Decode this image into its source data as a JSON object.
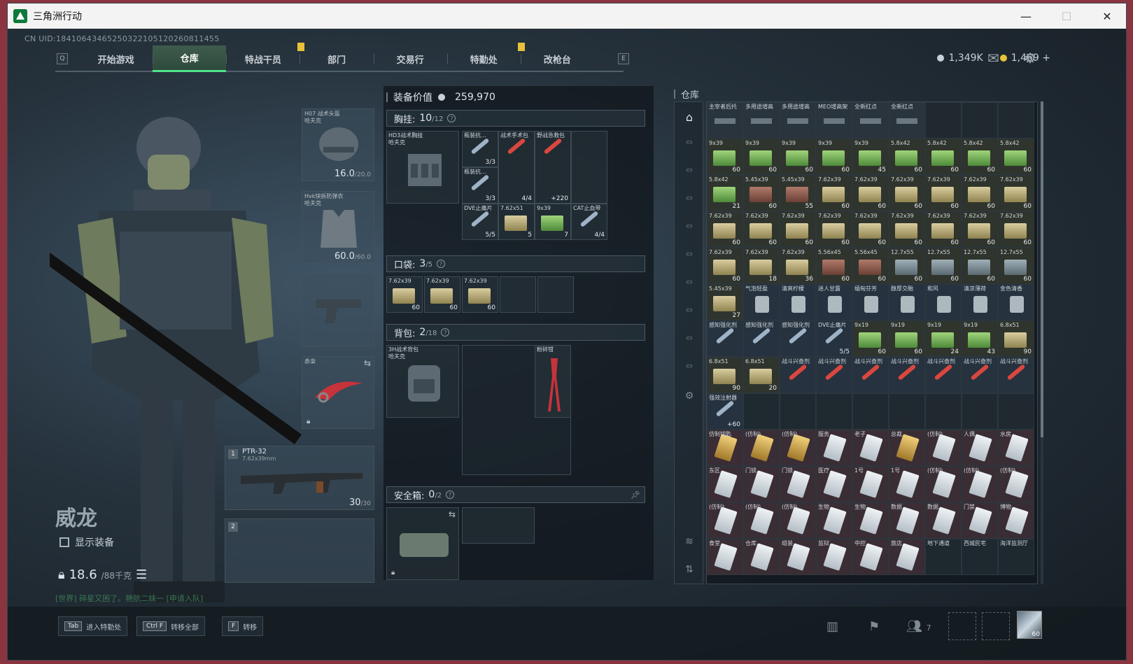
{
  "window": {
    "title": "三角洲行动",
    "minimize": "—",
    "maximize": "☐",
    "close": "✕"
  },
  "uid": "CN UID:18410643465250322105120260811455",
  "nav": {
    "left_key": "Q",
    "right_key": "E",
    "tabs": [
      "开始游戏",
      "仓库",
      "特战干员",
      "部门",
      "交易行",
      "特勤处",
      "改枪台"
    ],
    "active_index": 1
  },
  "currency": {
    "silver": "1,349K",
    "gold": "1,469",
    "plus": "+"
  },
  "character": {
    "name": "威龙",
    "show_equipment": "显示装备",
    "weight": "18.6",
    "weight_max": "/88千克",
    "chat": "[世界] 碎星又困了。艳航二妹一 [申请入队]"
  },
  "slots": {
    "helmet": {
      "label": "H07 战术头盔\n哈夫克",
      "value": "16.0",
      "max": "/20.0"
    },
    "armor": {
      "label": "Hvk快拆防弹衣\n哈夫克",
      "value": "60.0",
      "max": "/60.0"
    },
    "melee": {
      "label": "赤枭"
    },
    "primary": {
      "num": "1",
      "label": "PTR-32",
      "sub": "7.62x39mm",
      "value": "30",
      "max": "/30"
    },
    "secondary": {
      "num": "2"
    }
  },
  "gear": {
    "value_label": "装备价值",
    "value": "259,970",
    "chest": {
      "label": "胸挂:",
      "count": "10",
      "max": "/12",
      "rig": "HD3战术胸挂\n哈夫克"
    },
    "chest_items": [
      {
        "name": "瓶装抗…",
        "qty": "3/3"
      },
      {
        "name": "战术手术包",
        "qty": "4/4"
      },
      {
        "name": "野战急救包",
        "qty": "+220"
      },
      {
        "name": "瓶装抗…",
        "qty": "3/3"
      },
      {
        "name": "DVE止痛片",
        "qty": "5/5"
      },
      {
        "name": "7.62x51",
        "qty": "5"
      },
      {
        "name": "9x39",
        "qty": "7"
      },
      {
        "name": "CAT止血带",
        "qty": "4/4"
      }
    ],
    "pocket": {
      "label": "口袋:",
      "count": "3",
      "max": "/5",
      "items": [
        {
          "name": "7.62x39",
          "qty": "60"
        },
        {
          "name": "7.62x39",
          "qty": "60"
        },
        {
          "name": "7.62x39",
          "qty": "60"
        }
      ]
    },
    "backpack": {
      "label": "背包:",
      "count": "2",
      "max": "/18",
      "bag": "3H战术背包\n哈夫克",
      "tool": "粉碎钳"
    },
    "safe": {
      "label": "安全箱:",
      "count": "0",
      "max": "/2"
    }
  },
  "warehouse": {
    "title": "仓库",
    "rows": [
      [
        {
          "n": "主宰者后托",
          "k": "att"
        },
        {
          "n": "多用途增高",
          "k": "att"
        },
        {
          "n": "多用途增高",
          "k": "att"
        },
        {
          "n": "MEO增高架",
          "k": "att"
        },
        {
          "n": "全新红点",
          "k": "att"
        },
        {
          "n": "全新红点",
          "k": "att"
        },
        {
          "n": "",
          "k": "empty"
        },
        {
          "n": "",
          "k": "empty"
        },
        {
          "n": "",
          "k": "empty"
        }
      ],
      [
        {
          "n": "9x39",
          "q": "60",
          "k": "green"
        },
        {
          "n": "9x39",
          "q": "60",
          "k": "green"
        },
        {
          "n": "9x39",
          "q": "60",
          "k": "green"
        },
        {
          "n": "9x39",
          "q": "60",
          "k": "green"
        },
        {
          "n": "9x39",
          "q": "45",
          "k": "green"
        },
        {
          "n": "5.8x42",
          "q": "60",
          "k": "green"
        },
        {
          "n": "5.8x42",
          "q": "60",
          "k": "green"
        },
        {
          "n": "5.8x42",
          "q": "60",
          "k": "green"
        },
        {
          "n": "5.8x42",
          "q": "60",
          "k": "green"
        }
      ],
      [
        {
          "n": "5.8x42",
          "q": "21",
          "k": "green"
        },
        {
          "n": "5.45x39",
          "q": "60",
          "k": "rust"
        },
        {
          "n": "5.45x39",
          "q": "55",
          "k": "rust"
        },
        {
          "n": "7.62x39",
          "q": "60",
          "k": "tan"
        },
        {
          "n": "7.62x39",
          "q": "60",
          "k": "tan"
        },
        {
          "n": "7.62x39",
          "q": "60",
          "k": "tan"
        },
        {
          "n": "7.62x39",
          "q": "60",
          "k": "tan"
        },
        {
          "n": "7.62x39",
          "q": "60",
          "k": "tan"
        },
        {
          "n": "7.62x39",
          "q": "60",
          "k": "tan"
        }
      ],
      [
        {
          "n": "7.62x39",
          "q": "60",
          "k": "tan"
        },
        {
          "n": "7.62x39",
          "q": "60",
          "k": "tan"
        },
        {
          "n": "7.62x39",
          "q": "60",
          "k": "tan"
        },
        {
          "n": "7.62x39",
          "q": "60",
          "k": "tan"
        },
        {
          "n": "7.62x39",
          "q": "60",
          "k": "tan"
        },
        {
          "n": "7.62x39",
          "q": "60",
          "k": "tan"
        },
        {
          "n": "7.62x39",
          "q": "60",
          "k": "tan"
        },
        {
          "n": "7.62x39",
          "q": "60",
          "k": "tan"
        },
        {
          "n": "7.62x39",
          "q": "60",
          "k": "tan"
        }
      ],
      [
        {
          "n": "7.62x39",
          "q": "60",
          "k": "tan"
        },
        {
          "n": "7.62x39",
          "q": "18",
          "k": "tan"
        },
        {
          "n": "7.62x39",
          "q": "36",
          "k": "tan"
        },
        {
          "n": "5.56x45",
          "q": "60",
          "k": "rust"
        },
        {
          "n": "5.56x45",
          "q": "60",
          "k": "rust"
        },
        {
          "n": "12.7x55",
          "q": "60",
          "k": "grey"
        },
        {
          "n": "12.7x55",
          "q": "60",
          "k": "grey"
        },
        {
          "n": "12.7x55",
          "q": "60",
          "k": "grey"
        },
        {
          "n": "12.7x55",
          "q": "60",
          "k": "grey"
        }
      ],
      [
        {
          "n": "5.45x39",
          "q": "27",
          "k": "tan"
        },
        {
          "n": "气泡轻盈",
          "k": "drink"
        },
        {
          "n": "清爽柠檬",
          "k": "drink"
        },
        {
          "n": "迷人甘露",
          "k": "drink"
        },
        {
          "n": "缅甸芬芳",
          "k": "drink"
        },
        {
          "n": "醇厚交融",
          "k": "drink"
        },
        {
          "n": "和风",
          "k": "drink"
        },
        {
          "n": "清凉薄荷",
          "k": "drink"
        },
        {
          "n": "金色清香",
          "k": "drink"
        }
      ],
      [
        {
          "n": "感知强化剂",
          "k": "syr"
        },
        {
          "n": "感知强化剂",
          "k": "syr"
        },
        {
          "n": "感知强化剂",
          "k": "syr"
        },
        {
          "n": "DVE止痛片",
          "q": "5/5",
          "k": "syr"
        },
        {
          "n": "9x19",
          "q": "60",
          "k": "green"
        },
        {
          "n": "9x19",
          "q": "60",
          "k": "green"
        },
        {
          "n": "9x19",
          "q": "24",
          "k": "green"
        },
        {
          "n": "9x19",
          "q": "43",
          "k": "green"
        },
        {
          "n": "6.8x51",
          "q": "90",
          "k": "tan"
        }
      ],
      [
        {
          "n": "6.8x51",
          "q": "90",
          "k": "tan"
        },
        {
          "n": "6.8x51",
          "q": "20",
          "k": "tan"
        },
        {
          "n": "战斗兴奋剂",
          "k": "red"
        },
        {
          "n": "战斗兴奋剂",
          "k": "red"
        },
        {
          "n": "战斗兴奋剂",
          "k": "red"
        },
        {
          "n": "战斗兴奋剂",
          "k": "red"
        },
        {
          "n": "战斗兴奋剂",
          "k": "red"
        },
        {
          "n": "战斗兴奋剂",
          "k": "red"
        },
        {
          "n": "战斗兴奋剂",
          "k": "red"
        }
      ],
      [
        {
          "n": "强效注射器",
          "q": "+60",
          "k": "syr"
        },
        {
          "n": "",
          "k": "empty"
        },
        {
          "n": "",
          "k": "empty"
        },
        {
          "n": "",
          "k": "empty"
        },
        {
          "n": "",
          "k": "empty"
        },
        {
          "n": "",
          "k": "empty"
        },
        {
          "n": "",
          "k": "empty"
        },
        {
          "n": "",
          "k": "empty"
        },
        {
          "n": "",
          "k": "empty"
        }
      ],
      [
        {
          "n": "仿制钥匙",
          "k": "gold"
        },
        {
          "n": "(仿制)",
          "k": "gold"
        },
        {
          "n": "(仿制)",
          "k": "gold"
        },
        {
          "n": "服务",
          "k": "key"
        },
        {
          "n": "老子",
          "k": "key"
        },
        {
          "n": "总裁",
          "k": "gold"
        },
        {
          "n": "(仿制)",
          "k": "key"
        },
        {
          "n": "人偶",
          "k": "key"
        },
        {
          "n": "水房",
          "k": "key"
        }
      ],
      [
        {
          "n": "东区",
          "k": "key"
        },
        {
          "n": "门锁",
          "k": "key"
        },
        {
          "n": "门锁",
          "k": "key"
        },
        {
          "n": "医疗",
          "k": "key"
        },
        {
          "n": "1号",
          "k": "key"
        },
        {
          "n": "1号",
          "k": "key"
        },
        {
          "n": "(仿制)",
          "k": "key"
        },
        {
          "n": "(仿制)",
          "k": "key"
        },
        {
          "n": "(仿制)",
          "k": "key"
        }
      ],
      [
        {
          "n": "(仿制)",
          "k": "key"
        },
        {
          "n": "(仿制)",
          "k": "key"
        },
        {
          "n": "(仿制)",
          "k": "key"
        },
        {
          "n": "生物",
          "k": "key"
        },
        {
          "n": "生物",
          "k": "key"
        },
        {
          "n": "数据",
          "k": "key"
        },
        {
          "n": "数据",
          "k": "key"
        },
        {
          "n": "门禁",
          "k": "key"
        },
        {
          "n": "博物",
          "k": "key"
        }
      ],
      [
        {
          "n": "食堂",
          "k": "key"
        },
        {
          "n": "仓库",
          "k": "key"
        },
        {
          "n": "组装",
          "k": "key"
        },
        {
          "n": "监狱",
          "k": "key"
        },
        {
          "n": "中控",
          "k": "key"
        },
        {
          "n": "旅店",
          "k": "key"
        },
        {
          "n": "地下通道",
          "k": "empty2"
        },
        {
          "n": "西城民宅",
          "k": "empty2"
        },
        {
          "n": "海洋监测厅",
          "k": "empty2"
        }
      ]
    ]
  },
  "bottom": {
    "hints": [
      {
        "key": "Tab",
        "label": "进入特勤处"
      },
      {
        "key": "Ctrl F",
        "label": "转移全部"
      },
      {
        "key": "F",
        "label": "转移"
      }
    ],
    "squad_count": "7",
    "avatar_level": "60"
  },
  "icons": [
    "app-icon",
    "helmet-icon",
    "armor-icon",
    "pistol-icon",
    "knife-icon",
    "rifle-icon",
    "mail-icon",
    "settings-icon",
    "stats-icon",
    "flag-icon",
    "squad-icon"
  ]
}
